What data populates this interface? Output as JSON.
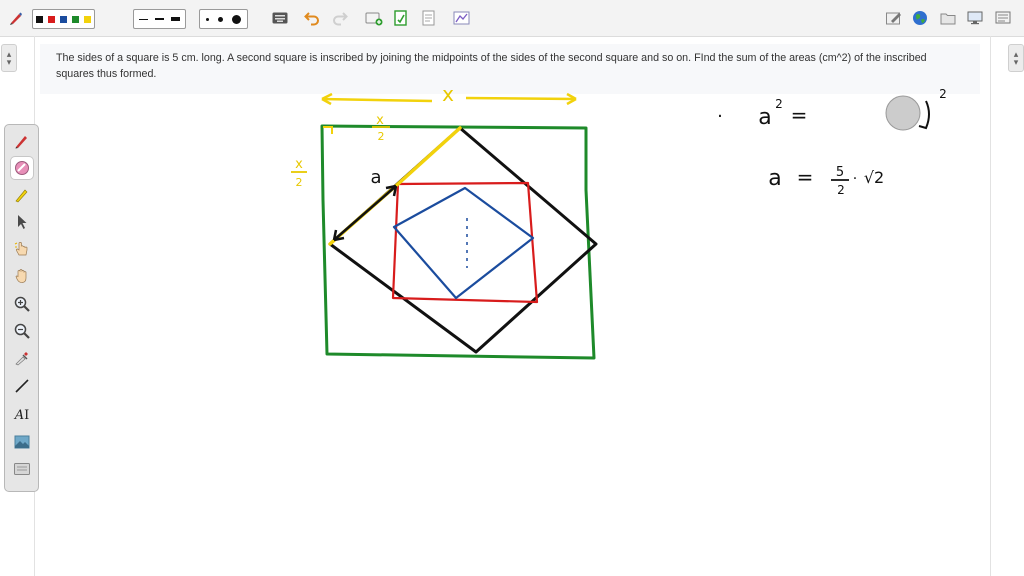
{
  "question": {
    "text": "The sides of a square is 5 cm. long. A second square is inscribed by joining the midpoints of the sides of the second square and so on. FInd the sum of the areas (cm^2) of the inscribed squares thus formed."
  },
  "toolbar": {
    "pen_colors": [
      "#111111",
      "#d81c1c",
      "#1b4c9e",
      "#1e8a2a",
      "#f2d20c"
    ],
    "line_widths": [
      "thin",
      "medium",
      "thick"
    ],
    "dot_sizes": [
      "small",
      "medium",
      "large"
    ]
  },
  "tools": [
    {
      "name": "pen-tool-icon"
    },
    {
      "name": "eraser-tool-icon"
    },
    {
      "name": "highlighter-tool-icon"
    },
    {
      "name": "select-arrow-icon"
    },
    {
      "name": "pointer-hand-icon"
    },
    {
      "name": "pan-hand-icon"
    },
    {
      "name": "zoom-in-icon"
    },
    {
      "name": "zoom-out-icon"
    },
    {
      "name": "color-picker-icon"
    },
    {
      "name": "line-tool-icon"
    },
    {
      "name": "text-tool-icon"
    },
    {
      "name": "image-tool-icon"
    },
    {
      "name": "keyboard-icon"
    }
  ],
  "handwriting": {
    "x_label": "x",
    "half_x_num": "x",
    "half_x_den": "2",
    "a_label": "a",
    "eq1_lhs": "a",
    "eq1_exp": "2",
    "eq1_eq": "=",
    "outer_exp": "2",
    "eq2_lhs": "a",
    "eq2_eq": "=",
    "eq2_num": "5",
    "eq2_den": "2",
    "eq2_root": "√2",
    "bullet": "·"
  },
  "colors": {
    "green_square": "#1e8a2a",
    "black_square": "#111111",
    "red_square": "#d81c1c",
    "blue_square": "#1b4c9e",
    "yellow_ink": "#f2d20c"
  }
}
